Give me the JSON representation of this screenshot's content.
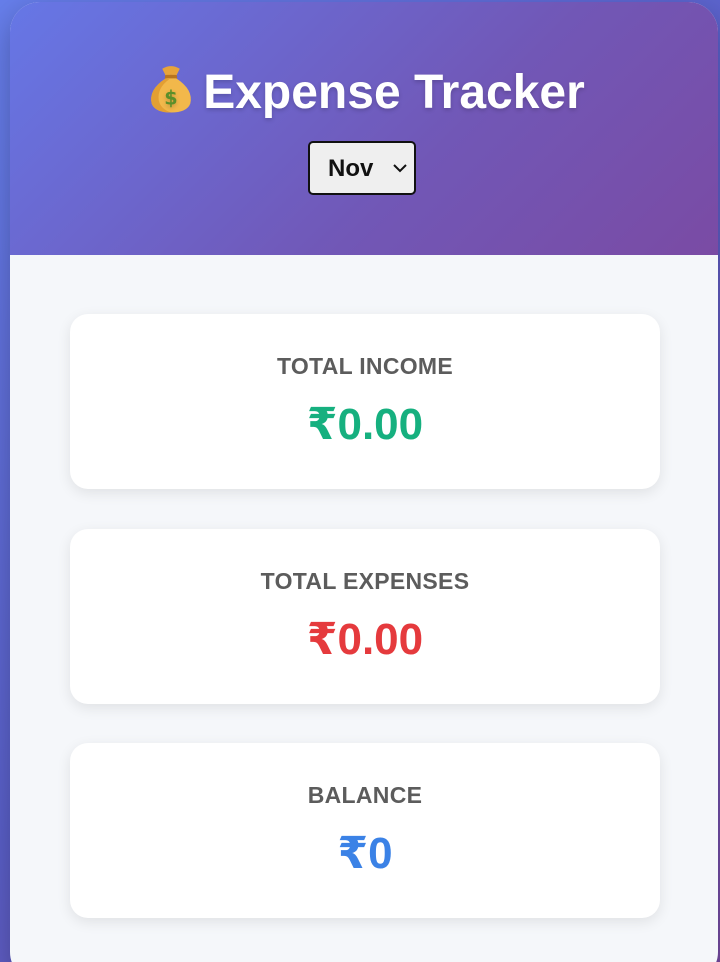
{
  "header": {
    "title": "Expense Tracker",
    "title_icon": "money-bag-icon",
    "month_select": {
      "selected": "Nov"
    }
  },
  "summary": {
    "income": {
      "label": "TOTAL INCOME",
      "value": "₹0.00"
    },
    "expenses": {
      "label": "TOTAL EXPENSES",
      "value": "₹0.00"
    },
    "balance": {
      "label": "BALANCE",
      "value": "₹0"
    }
  },
  "colors": {
    "income": "#16b07f",
    "expenses": "#e53a3d",
    "balance": "#3b82e6",
    "header_gradient_start": "#6677e6",
    "header_gradient_end": "#7a4ba4"
  }
}
